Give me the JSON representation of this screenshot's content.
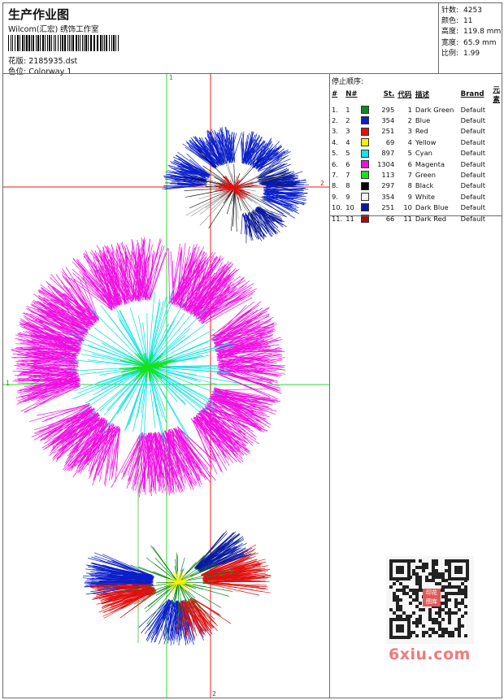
{
  "header": {
    "title": "生产作业图",
    "company": "Wilcom(汇宏) 绣饰工作室",
    "file_label": "花版:",
    "file_value": "2185935.dst",
    "colorway_label": "色位:",
    "colorway_value": "Colorway 1"
  },
  "stats": [
    {
      "label": "针数:",
      "value": "4253"
    },
    {
      "label": "颜色:",
      "value": "11"
    },
    {
      "label": "高度:",
      "value": "119.8 mm"
    },
    {
      "label": "宽度:",
      "value": "65.9 mm"
    },
    {
      "label": "比例:",
      "value": "1.99"
    }
  ],
  "stop_panel": {
    "title": "停止顺序:",
    "columns": [
      "#",
      "N#",
      "St.",
      "代码",
      "描述",
      "Brand",
      "元素"
    ],
    "rows": [
      {
        "idx": "1.",
        "n": "1",
        "color": "#0d8a1f",
        "st": "295",
        "code": "1",
        "desc": "Dark Green",
        "brand": "Default"
      },
      {
        "idx": "2.",
        "n": "2",
        "color": "#0a1fc9",
        "st": "354",
        "code": "2",
        "desc": "Blue",
        "brand": "Default"
      },
      {
        "idx": "3.",
        "n": "3",
        "color": "#e01010",
        "st": "251",
        "code": "3",
        "desc": "Red",
        "brand": "Default"
      },
      {
        "idx": "4.",
        "n": "4",
        "color": "#f5f200",
        "st": "69",
        "code": "4",
        "desc": "Yellow",
        "brand": "Default"
      },
      {
        "idx": "5.",
        "n": "5",
        "color": "#16e4e4",
        "st": "897",
        "code": "5",
        "desc": "Cyan",
        "brand": "Default"
      },
      {
        "idx": "6.",
        "n": "6",
        "color": "#ef0fe2",
        "st": "1304",
        "code": "6",
        "desc": "Magenta",
        "brand": "Default"
      },
      {
        "idx": "7.",
        "n": "7",
        "color": "#19e019",
        "st": "113",
        "code": "7",
        "desc": "Green",
        "brand": "Default"
      },
      {
        "idx": "8.",
        "n": "8",
        "color": "#000000",
        "st": "297",
        "code": "8",
        "desc": "Black",
        "brand": "Default"
      },
      {
        "idx": "9.",
        "n": "9",
        "color": "#f4f4f4",
        "st": "354",
        "code": "9",
        "desc": "White",
        "brand": "Default"
      },
      {
        "idx": "10.",
        "n": "10",
        "color": "#0a1a9e",
        "st": "251",
        "code": "10",
        "desc": "Dark Blue",
        "brand": "Default"
      },
      {
        "idx": "11.",
        "n": "11",
        "color": "#a31010",
        "st": "66",
        "code": "11",
        "desc": "Dark Red",
        "brand": "Default"
      }
    ]
  },
  "guides": {
    "v1_label": "1",
    "h1_label": "1",
    "v2_label": "2",
    "h2_label": "2"
  },
  "watermark": {
    "text": "6xiu.com",
    "badge_top": "印花",
    "badge_bottom": "图库"
  },
  "colors": {
    "guide_green": "#2bd62b",
    "guide_red": "#e51a1a",
    "frame": "#6b6b6b"
  }
}
